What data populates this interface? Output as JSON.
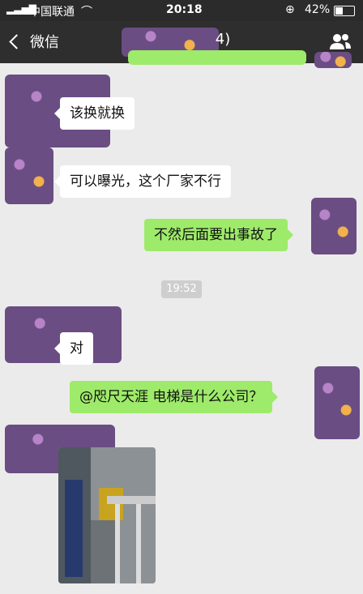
{
  "status": {
    "carrier": "中国联通",
    "time": "20:18",
    "battery": "42%"
  },
  "nav": {
    "back_label": "微信",
    "title_suffix": "4)"
  },
  "messages": [
    {
      "side": "left",
      "text": "该换就换"
    },
    {
      "side": "left",
      "text": "可以曝光，这个厂家不行"
    },
    {
      "side": "right",
      "text": "不然后面要出事故了"
    },
    {
      "side": "left",
      "text": "对"
    },
    {
      "side": "right",
      "text": "@咫尺天涯  电梯是什么公司？"
    }
  ],
  "time_divider": "19:52",
  "colors": {
    "statusbar": "#2b2b2b",
    "navbar": "#2e2e2e",
    "bg": "#ebebeb",
    "bubble_right": "#9eea6a",
    "bubble_left": "#ffffff"
  }
}
